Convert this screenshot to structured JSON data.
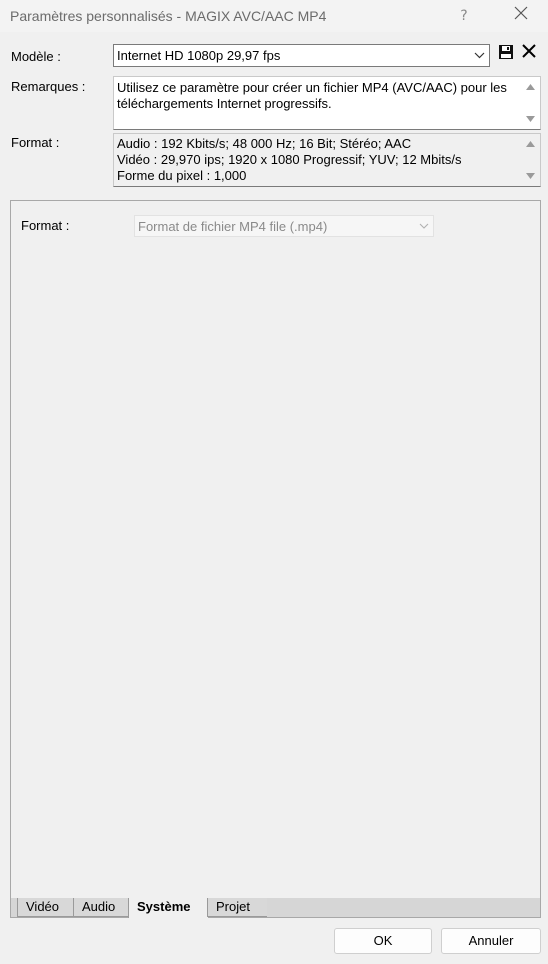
{
  "window": {
    "title": "Paramètres personnalisés - MAGIX AVC/AAC MP4",
    "help_label": "?",
    "close_icon": "close-icon"
  },
  "model": {
    "label": "Modèle :",
    "value": "Internet HD 1080p 29,97 fps",
    "save_icon": "save-disk-icon",
    "delete_icon": "delete-x-icon"
  },
  "remarks": {
    "label": "Remarques :",
    "text": "Utilisez ce paramètre pour créer un fichier MP4 (AVC/AAC) pour les téléchargements Internet progressifs."
  },
  "format_info": {
    "label": "Format :",
    "lines": [
      "Audio : 192 Kbits/s; 48 000 Hz; 16 Bit; Stéréo; AAC",
      "Vidéo : 29,970 ips; 1920 x 1080 Progressif; YUV; 12 Mbits/s",
      "Forme du pixel : 1,000"
    ]
  },
  "system_panel": {
    "format_label": "Format :",
    "format_value": "Format de fichier MP4 file (.mp4)"
  },
  "tabs": [
    {
      "label": "Vidéo",
      "active": false
    },
    {
      "label": "Audio",
      "active": false
    },
    {
      "label": "Système",
      "active": true
    },
    {
      "label": "Projet",
      "active": false
    }
  ],
  "buttons": {
    "ok": "OK",
    "cancel": "Annuler"
  },
  "colors": {
    "background": "#f0f0f0",
    "border": "#a8a8a8",
    "disabled_text": "#8a8a8a"
  }
}
